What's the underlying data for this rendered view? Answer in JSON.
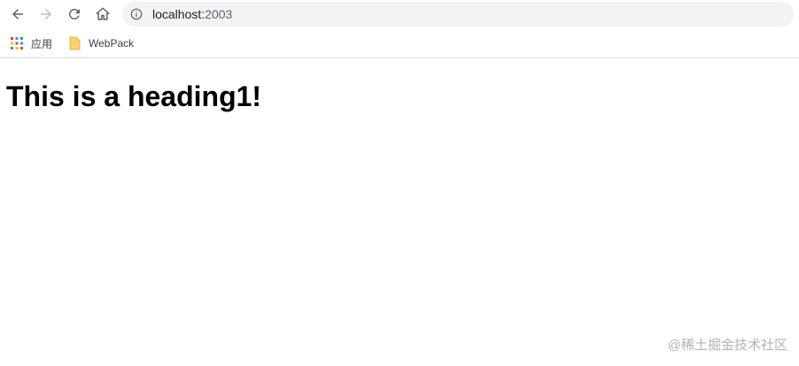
{
  "browser": {
    "address_bar": {
      "host": "localhost:",
      "port": "2003"
    },
    "bookmarks": [
      {
        "label": "应用",
        "icon": "apps-grid-icon"
      },
      {
        "label": "WebPack",
        "icon": "folder-icon"
      }
    ]
  },
  "page": {
    "heading": "This is a heading1!"
  },
  "watermark": "@稀土掘金技术社区",
  "colors": {
    "omnibox_bg": "#f1f3f4",
    "nav_icon": "#5f6368",
    "nav_icon_disabled": "#bdc1c6",
    "folder": "#f6d36a"
  }
}
